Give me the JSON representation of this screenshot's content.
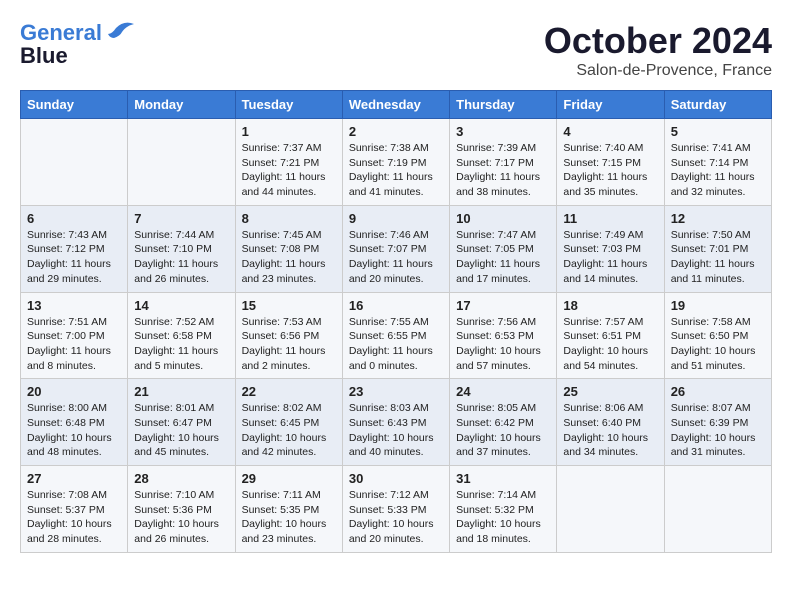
{
  "header": {
    "logo_line1": "General",
    "logo_line2": "Blue",
    "month": "October 2024",
    "location": "Salon-de-Provence, France"
  },
  "days_of_week": [
    "Sunday",
    "Monday",
    "Tuesday",
    "Wednesday",
    "Thursday",
    "Friday",
    "Saturday"
  ],
  "weeks": [
    [
      {
        "day": "",
        "info": ""
      },
      {
        "day": "",
        "info": ""
      },
      {
        "day": "1",
        "info": "Sunrise: 7:37 AM\nSunset: 7:21 PM\nDaylight: 11 hours\nand 44 minutes."
      },
      {
        "day": "2",
        "info": "Sunrise: 7:38 AM\nSunset: 7:19 PM\nDaylight: 11 hours\nand 41 minutes."
      },
      {
        "day": "3",
        "info": "Sunrise: 7:39 AM\nSunset: 7:17 PM\nDaylight: 11 hours\nand 38 minutes."
      },
      {
        "day": "4",
        "info": "Sunrise: 7:40 AM\nSunset: 7:15 PM\nDaylight: 11 hours\nand 35 minutes."
      },
      {
        "day": "5",
        "info": "Sunrise: 7:41 AM\nSunset: 7:14 PM\nDaylight: 11 hours\nand 32 minutes."
      }
    ],
    [
      {
        "day": "6",
        "info": "Sunrise: 7:43 AM\nSunset: 7:12 PM\nDaylight: 11 hours\nand 29 minutes."
      },
      {
        "day": "7",
        "info": "Sunrise: 7:44 AM\nSunset: 7:10 PM\nDaylight: 11 hours\nand 26 minutes."
      },
      {
        "day": "8",
        "info": "Sunrise: 7:45 AM\nSunset: 7:08 PM\nDaylight: 11 hours\nand 23 minutes."
      },
      {
        "day": "9",
        "info": "Sunrise: 7:46 AM\nSunset: 7:07 PM\nDaylight: 11 hours\nand 20 minutes."
      },
      {
        "day": "10",
        "info": "Sunrise: 7:47 AM\nSunset: 7:05 PM\nDaylight: 11 hours\nand 17 minutes."
      },
      {
        "day": "11",
        "info": "Sunrise: 7:49 AM\nSunset: 7:03 PM\nDaylight: 11 hours\nand 14 minutes."
      },
      {
        "day": "12",
        "info": "Sunrise: 7:50 AM\nSunset: 7:01 PM\nDaylight: 11 hours\nand 11 minutes."
      }
    ],
    [
      {
        "day": "13",
        "info": "Sunrise: 7:51 AM\nSunset: 7:00 PM\nDaylight: 11 hours\nand 8 minutes."
      },
      {
        "day": "14",
        "info": "Sunrise: 7:52 AM\nSunset: 6:58 PM\nDaylight: 11 hours\nand 5 minutes."
      },
      {
        "day": "15",
        "info": "Sunrise: 7:53 AM\nSunset: 6:56 PM\nDaylight: 11 hours\nand 2 minutes."
      },
      {
        "day": "16",
        "info": "Sunrise: 7:55 AM\nSunset: 6:55 PM\nDaylight: 11 hours\nand 0 minutes."
      },
      {
        "day": "17",
        "info": "Sunrise: 7:56 AM\nSunset: 6:53 PM\nDaylight: 10 hours\nand 57 minutes."
      },
      {
        "day": "18",
        "info": "Sunrise: 7:57 AM\nSunset: 6:51 PM\nDaylight: 10 hours\nand 54 minutes."
      },
      {
        "day": "19",
        "info": "Sunrise: 7:58 AM\nSunset: 6:50 PM\nDaylight: 10 hours\nand 51 minutes."
      }
    ],
    [
      {
        "day": "20",
        "info": "Sunrise: 8:00 AM\nSunset: 6:48 PM\nDaylight: 10 hours\nand 48 minutes."
      },
      {
        "day": "21",
        "info": "Sunrise: 8:01 AM\nSunset: 6:47 PM\nDaylight: 10 hours\nand 45 minutes."
      },
      {
        "day": "22",
        "info": "Sunrise: 8:02 AM\nSunset: 6:45 PM\nDaylight: 10 hours\nand 42 minutes."
      },
      {
        "day": "23",
        "info": "Sunrise: 8:03 AM\nSunset: 6:43 PM\nDaylight: 10 hours\nand 40 minutes."
      },
      {
        "day": "24",
        "info": "Sunrise: 8:05 AM\nSunset: 6:42 PM\nDaylight: 10 hours\nand 37 minutes."
      },
      {
        "day": "25",
        "info": "Sunrise: 8:06 AM\nSunset: 6:40 PM\nDaylight: 10 hours\nand 34 minutes."
      },
      {
        "day": "26",
        "info": "Sunrise: 8:07 AM\nSunset: 6:39 PM\nDaylight: 10 hours\nand 31 minutes."
      }
    ],
    [
      {
        "day": "27",
        "info": "Sunrise: 7:08 AM\nSunset: 5:37 PM\nDaylight: 10 hours\nand 28 minutes."
      },
      {
        "day": "28",
        "info": "Sunrise: 7:10 AM\nSunset: 5:36 PM\nDaylight: 10 hours\nand 26 minutes."
      },
      {
        "day": "29",
        "info": "Sunrise: 7:11 AM\nSunset: 5:35 PM\nDaylight: 10 hours\nand 23 minutes."
      },
      {
        "day": "30",
        "info": "Sunrise: 7:12 AM\nSunset: 5:33 PM\nDaylight: 10 hours\nand 20 minutes."
      },
      {
        "day": "31",
        "info": "Sunrise: 7:14 AM\nSunset: 5:32 PM\nDaylight: 10 hours\nand 18 minutes."
      },
      {
        "day": "",
        "info": ""
      },
      {
        "day": "",
        "info": ""
      }
    ]
  ]
}
